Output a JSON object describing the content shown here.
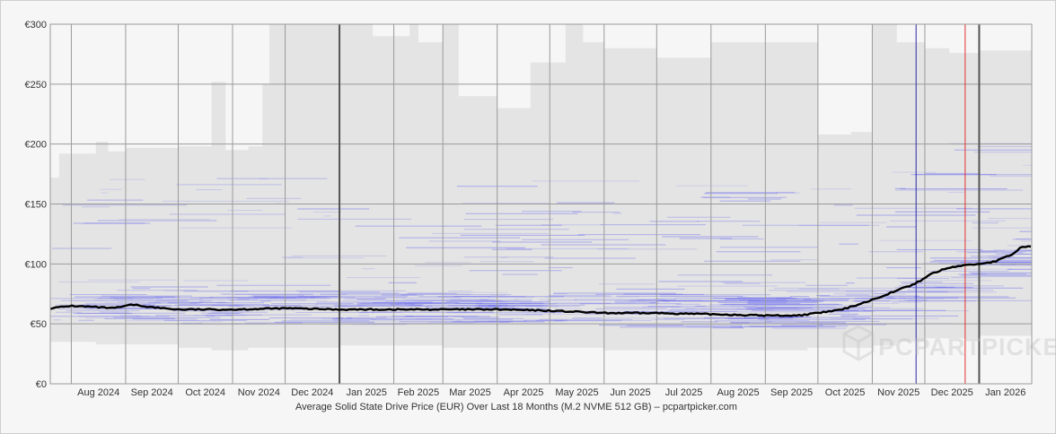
{
  "chart_data": {
    "type": "area",
    "caption": "Average Solid State Drive Price (EUR) Over Last 18 Months (M.2 NVME 512 GB) – pcpartpicker.com",
    "ylim": [
      0,
      300
    ],
    "xlim": [
      "2024-07-20",
      "2026-01-31"
    ],
    "y_ticks": [
      {
        "value": 0,
        "label": "€0"
      },
      {
        "value": 50,
        "label": "€50"
      },
      {
        "value": 100,
        "label": "€100"
      },
      {
        "value": 150,
        "label": "€150"
      },
      {
        "value": 200,
        "label": "€200"
      },
      {
        "value": 250,
        "label": "€250"
      },
      {
        "value": 300,
        "label": "€300"
      }
    ],
    "x_ticks": [
      {
        "date": "2024-08-01",
        "label": "Aug 2024"
      },
      {
        "date": "2024-09-01",
        "label": "Sep 2024"
      },
      {
        "date": "2024-10-01",
        "label": "Oct 2024"
      },
      {
        "date": "2024-11-01",
        "label": "Nov 2024"
      },
      {
        "date": "2024-12-01",
        "label": "Dec 2024"
      },
      {
        "date": "2025-01-01",
        "label": "Jan 2025"
      },
      {
        "date": "2025-02-01",
        "label": "Feb 2025"
      },
      {
        "date": "2025-03-01",
        "label": "Mar 2025"
      },
      {
        "date": "2025-04-01",
        "label": "Apr 2025"
      },
      {
        "date": "2025-05-01",
        "label": "May 2025"
      },
      {
        "date": "2025-06-01",
        "label": "Jun 2025"
      },
      {
        "date": "2025-07-01",
        "label": "Jul 2025"
      },
      {
        "date": "2025-08-01",
        "label": "Aug 2025"
      },
      {
        "date": "2025-09-01",
        "label": "Sep 2025"
      },
      {
        "date": "2025-10-01",
        "label": "Oct 2025"
      },
      {
        "date": "2025-11-01",
        "label": "Nov 2025"
      },
      {
        "date": "2025-12-01",
        "label": "Dec 2025"
      },
      {
        "date": "2026-01-01",
        "label": "Jan 2026"
      }
    ],
    "grid": true,
    "year_markers": [
      "2025-01-01",
      "2026-01-01"
    ],
    "event_markers": [
      {
        "date": "2025-11-26",
        "color": "#2a2aa8"
      },
      {
        "date": "2025-12-24",
        "color": "#e03030"
      }
    ],
    "average_series": [
      {
        "x": "2024-07-20",
        "y": 63
      },
      {
        "x": "2024-08-01",
        "y": 65
      },
      {
        "x": "2024-08-15",
        "y": 64
      },
      {
        "x": "2024-08-25",
        "y": 63
      },
      {
        "x": "2024-09-05",
        "y": 66
      },
      {
        "x": "2024-09-15",
        "y": 64
      },
      {
        "x": "2024-10-01",
        "y": 62
      },
      {
        "x": "2024-11-01",
        "y": 62
      },
      {
        "x": "2024-12-01",
        "y": 63
      },
      {
        "x": "2025-01-01",
        "y": 62
      },
      {
        "x": "2025-02-01",
        "y": 62
      },
      {
        "x": "2025-03-01",
        "y": 62
      },
      {
        "x": "2025-04-01",
        "y": 62
      },
      {
        "x": "2025-05-01",
        "y": 61
      },
      {
        "x": "2025-06-01",
        "y": 59
      },
      {
        "x": "2025-07-01",
        "y": 59
      },
      {
        "x": "2025-08-01",
        "y": 58
      },
      {
        "x": "2025-09-01",
        "y": 57
      },
      {
        "x": "2025-09-20",
        "y": 57
      },
      {
        "x": "2025-10-01",
        "y": 59
      },
      {
        "x": "2025-10-15",
        "y": 62
      },
      {
        "x": "2025-11-01",
        "y": 70
      },
      {
        "x": "2025-11-15",
        "y": 78
      },
      {
        "x": "2025-11-25",
        "y": 83
      },
      {
        "x": "2025-12-05",
        "y": 92
      },
      {
        "x": "2025-12-15",
        "y": 97
      },
      {
        "x": "2025-12-24",
        "y": 99
      },
      {
        "x": "2026-01-01",
        "y": 100
      },
      {
        "x": "2026-01-10",
        "y": 102
      },
      {
        "x": "2026-01-20",
        "y": 108
      },
      {
        "x": "2026-01-25",
        "y": 114
      },
      {
        "x": "2026-01-31",
        "y": 115
      }
    ],
    "price_range_band": [
      {
        "x": "2024-07-20",
        "low": 35,
        "high": 172
      },
      {
        "x": "2024-07-25",
        "low": 35,
        "high": 192
      },
      {
        "x": "2024-08-15",
        "low": 33,
        "high": 202
      },
      {
        "x": "2024-08-22",
        "low": 33,
        "high": 194
      },
      {
        "x": "2024-09-01",
        "low": 33,
        "high": 197
      },
      {
        "x": "2024-10-01",
        "low": 30,
        "high": 198
      },
      {
        "x": "2024-10-20",
        "low": 28,
        "high": 252
      },
      {
        "x": "2024-10-28",
        "low": 28,
        "high": 195
      },
      {
        "x": "2024-11-10",
        "low": 30,
        "high": 198
      },
      {
        "x": "2024-11-18",
        "low": 30,
        "high": 250
      },
      {
        "x": "2024-11-22",
        "low": 30,
        "high": 300
      },
      {
        "x": "2025-01-01",
        "low": 32,
        "high": 300
      },
      {
        "x": "2025-01-20",
        "low": 32,
        "high": 290
      },
      {
        "x": "2025-02-10",
        "low": 32,
        "high": 300
      },
      {
        "x": "2025-02-15",
        "low": 32,
        "high": 285
      },
      {
        "x": "2025-03-01",
        "low": 30,
        "high": 300
      },
      {
        "x": "2025-03-10",
        "low": 30,
        "high": 240
      },
      {
        "x": "2025-04-01",
        "low": 30,
        "high": 230
      },
      {
        "x": "2025-04-20",
        "low": 30,
        "high": 268
      },
      {
        "x": "2025-05-10",
        "low": 30,
        "high": 300
      },
      {
        "x": "2025-05-20",
        "low": 30,
        "high": 285
      },
      {
        "x": "2025-06-01",
        "low": 28,
        "high": 280
      },
      {
        "x": "2025-07-01",
        "low": 28,
        "high": 272
      },
      {
        "x": "2025-08-01",
        "low": 28,
        "high": 285
      },
      {
        "x": "2025-09-01",
        "low": 28,
        "high": 285
      },
      {
        "x": "2025-09-25",
        "low": 30,
        "high": 285
      },
      {
        "x": "2025-10-01",
        "low": 30,
        "high": 208
      },
      {
        "x": "2025-10-20",
        "low": 30,
        "high": 210
      },
      {
        "x": "2025-11-01",
        "low": 32,
        "high": 300
      },
      {
        "x": "2025-11-15",
        "low": 35,
        "high": 285
      },
      {
        "x": "2025-12-01",
        "low": 38,
        "high": 280
      },
      {
        "x": "2025-12-15",
        "low": 38,
        "high": 276
      },
      {
        "x": "2026-01-01",
        "low": 40,
        "high": 278
      },
      {
        "x": "2026-01-31",
        "low": 40,
        "high": 280
      }
    ],
    "watermark": "PCPARTPICKER"
  }
}
